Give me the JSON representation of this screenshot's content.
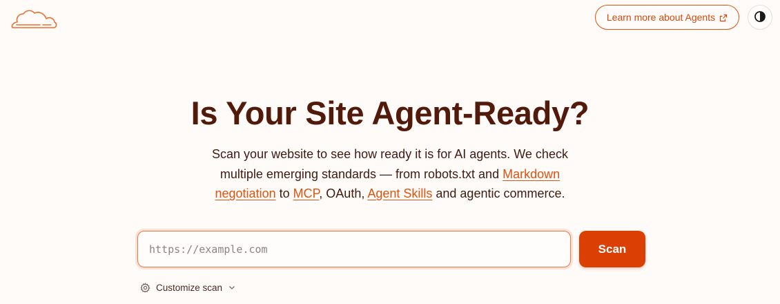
{
  "header": {
    "logo_icon": "cloudflare-cloud-icon",
    "learn_more_label": "Learn more about Agents",
    "learn_more_icon": "external-link-icon",
    "theme_toggle_icon": "contrast-icon"
  },
  "hero": {
    "title": "Is Your Site Agent-Ready?",
    "description": {
      "part1": "Scan your website to see how ready it is for AI agents. We check multiple emerging standards — from robots.txt and ",
      "link_markdown": "Markdown negotiation",
      "part2": " to ",
      "link_mcp": "MCP",
      "part3": ", OAuth, ",
      "link_skills": "Agent Skills",
      "part4": " and agentic commerce."
    }
  },
  "scan": {
    "input_value": "",
    "input_placeholder": "https://example.com",
    "button_label": "Scan"
  },
  "options": {
    "customize_label": "Customize scan",
    "customize_icon": "gear-icon",
    "chevron_icon": "chevron-down-icon"
  },
  "colors": {
    "accent": "#dc3f03",
    "link": "#e0520f",
    "heading": "#521a0b",
    "background": "#fefbf9"
  }
}
